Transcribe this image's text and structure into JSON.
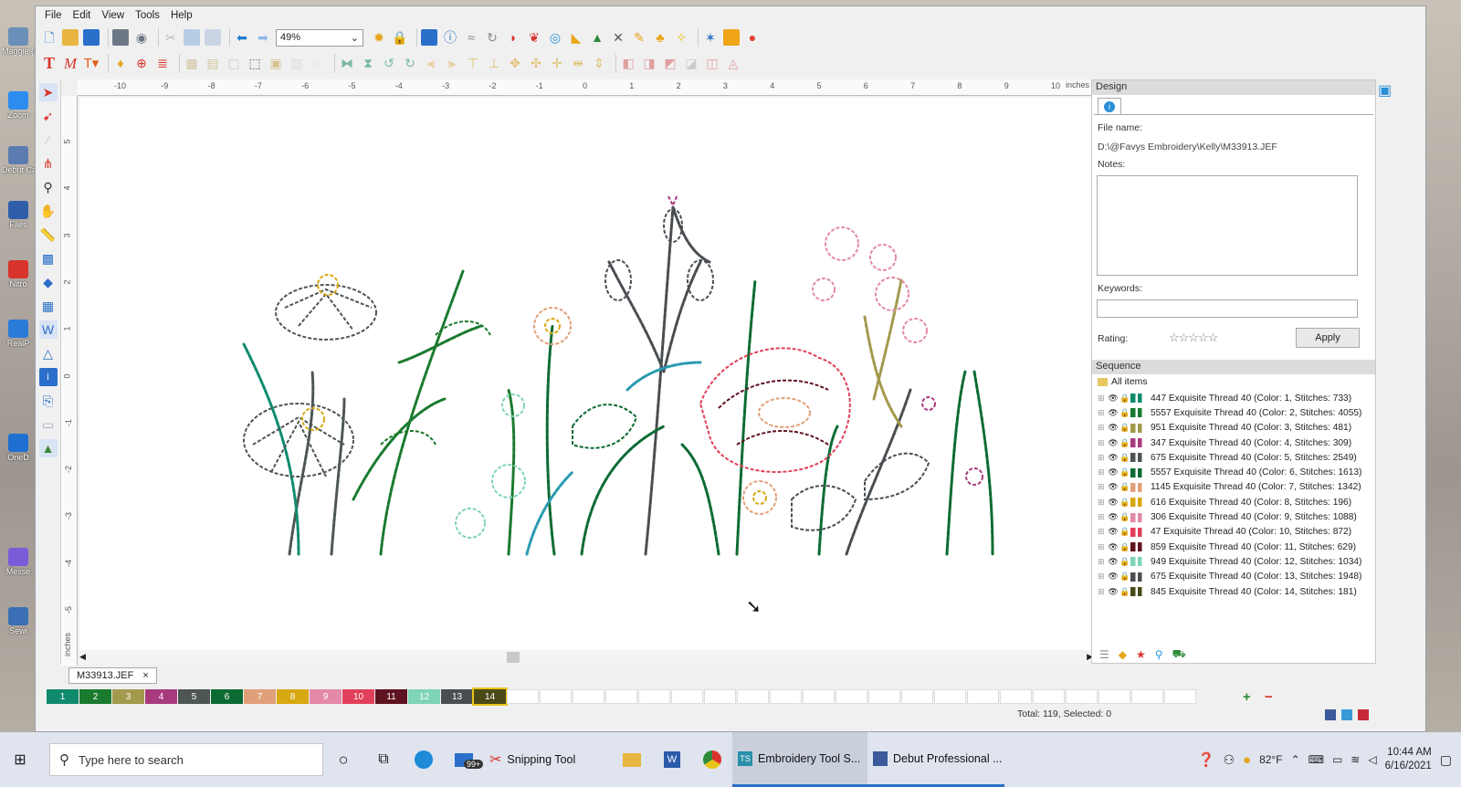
{
  "desktop": {
    "icons": [
      "Maggie (adivas)",
      "Zoom",
      "Debut Capture",
      "Files",
      "Nitro",
      "RealP",
      "OneD",
      "Messe",
      "Sewi"
    ]
  },
  "menu": [
    "File",
    "Edit",
    "View",
    "Tools",
    "Help"
  ],
  "toolbar": {
    "zoom_value": "49%"
  },
  "ruler": {
    "unit": "inches",
    "top_ticks": [
      "-10",
      "-9",
      "-8",
      "-7",
      "-6",
      "-5",
      "-4",
      "-3",
      "-2",
      "-1",
      "0",
      "1",
      "2",
      "3",
      "4",
      "5",
      "6",
      "7",
      "8",
      "9",
      "10"
    ],
    "left_ticks": [
      "5",
      "4",
      "3",
      "2",
      "1",
      "0",
      "-1",
      "-2",
      "-3",
      "-4",
      "-5"
    ]
  },
  "document_tab": {
    "name": "M33913.JEF",
    "close": "×"
  },
  "color_swatches": [
    {
      "n": "1",
      "color": "#0f8a6d"
    },
    {
      "n": "2",
      "color": "#1a7a2e"
    },
    {
      "n": "3",
      "color": "#a29a4c"
    },
    {
      "n": "4",
      "color": "#a83a7e"
    },
    {
      "n": "5",
      "color": "#4e5654"
    },
    {
      "n": "6",
      "color": "#0c6b33"
    },
    {
      "n": "7",
      "color": "#e2a07a"
    },
    {
      "n": "8",
      "color": "#d8a812"
    },
    {
      "n": "9",
      "color": "#e28aa7"
    },
    {
      "n": "10",
      "color": "#e2405a"
    },
    {
      "n": "11",
      "color": "#5e1420"
    },
    {
      "n": "12",
      "color": "#7fd4b6"
    },
    {
      "n": "13",
      "color": "#4a4e52"
    },
    {
      "n": "14",
      "color": "#4a4a18"
    }
  ],
  "status": {
    "total": "Total: 119, Selected: 0"
  },
  "design_panel": {
    "title": "Design",
    "file_name_label": "File name:",
    "file_path": "D:\\@Favys Embroidery\\Kelly\\M33913.JEF",
    "notes_label": "Notes:",
    "keywords_label": "Keywords:",
    "rating_label": "Rating:",
    "stars": "☆☆☆☆☆",
    "apply_label": "Apply"
  },
  "sequence": {
    "title": "Sequence",
    "all_items": "All items",
    "items": [
      {
        "label": "447 Exquisite Thread 40 (Color: 1, Stitches: 733)",
        "color": "#0f8a6d"
      },
      {
        "label": "5557 Exquisite Thread 40 (Color: 2, Stitches: 4055)",
        "color": "#1a7a2e"
      },
      {
        "label": "951 Exquisite Thread 40 (Color: 3, Stitches: 481)",
        "color": "#a29a4c"
      },
      {
        "label": "347 Exquisite Thread 40 (Color: 4, Stitches: 309)",
        "color": "#a83a7e"
      },
      {
        "label": "675 Exquisite Thread 40 (Color: 5, Stitches: 2549)",
        "color": "#4e5654"
      },
      {
        "label": "5557 Exquisite Thread 40 (Color: 6, Stitches: 1613)",
        "color": "#0c6b33"
      },
      {
        "label": "1145 Exquisite Thread 40 (Color: 7, Stitches: 1342)",
        "color": "#e2a07a"
      },
      {
        "label": "616 Exquisite Thread 40 (Color: 8, Stitches: 196)",
        "color": "#d8a812"
      },
      {
        "label": "306 Exquisite Thread 40 (Color: 9, Stitches: 1088)",
        "color": "#e28aa7"
      },
      {
        "label": "47 Exquisite Thread 40 (Color: 10, Stitches: 872)",
        "color": "#e2405a"
      },
      {
        "label": "859 Exquisite Thread 40 (Color: 11, Stitches: 629)",
        "color": "#5e1420"
      },
      {
        "label": "949 Exquisite Thread 40 (Color: 12, Stitches: 1034)",
        "color": "#7fd4b6"
      },
      {
        "label": "675 Exquisite Thread 40 (Color: 13, Stitches: 1948)",
        "color": "#4a4e52"
      },
      {
        "label": "845 Exquisite Thread 40 (Color: 14, Stitches: 181)",
        "color": "#4a4a18"
      }
    ]
  },
  "taskbar": {
    "search_placeholder": "Type here to search",
    "mail_badge": "99+",
    "apps": [
      {
        "label": "Snipping Tool"
      },
      {
        "label": "Embroidery Tool S..."
      },
      {
        "label": "Debut Professional ..."
      }
    ],
    "weather": "82°F",
    "time": "10:44 AM",
    "date": "6/16/2021"
  }
}
